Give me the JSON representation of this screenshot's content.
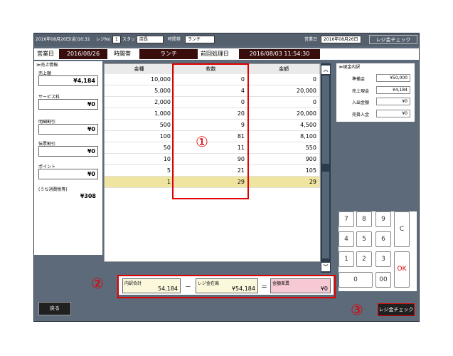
{
  "header": {
    "date_time": "2016年08月26日(金)16:32",
    "regi_no_label": "レジNo",
    "regi_no": "1",
    "staff_label": "スタッフ",
    "staff": "店長",
    "time_zone_label": "時間帯",
    "time_zone": "ランチ",
    "business_day_label": "営業日",
    "business_day": "2016年08月26日",
    "regi_check_button": "レジ金チェック"
  },
  "info": {
    "business_day_label": "営業日",
    "business_day": "2016/08/26",
    "time_zone_label": "時間帯",
    "time_zone": "ランチ",
    "last_process_label": "前回処理日",
    "last_process": "2016/08/03 11:54:30"
  },
  "sales": {
    "title": "≫売上情報",
    "items": [
      {
        "label": "売上額",
        "value": "¥4,184"
      },
      {
        "label": "サービス料",
        "value": "¥0"
      },
      {
        "label": "明細割引",
        "value": "¥0"
      },
      {
        "label": "伝票割引",
        "value": "¥0"
      },
      {
        "label": "ポイント",
        "value": "¥0"
      },
      {
        "label": "(うち消費税等)",
        "value": "¥308"
      }
    ]
  },
  "grid": {
    "headers": [
      "金種",
      "枚数",
      "金額"
    ],
    "rows": [
      [
        "10,000",
        "0",
        "0"
      ],
      [
        "5,000",
        "4",
        "20,000"
      ],
      [
        "2,000",
        "0",
        "0"
      ],
      [
        "1,000",
        "20",
        "20,000"
      ],
      [
        "500",
        "9",
        "4,500"
      ],
      [
        "100",
        "81",
        "8,100"
      ],
      [
        "50",
        "11",
        "550"
      ],
      [
        "10",
        "90",
        "900"
      ],
      [
        "5",
        "21",
        "105"
      ],
      [
        "1",
        "29",
        "29"
      ]
    ]
  },
  "cash": {
    "title": "≫現金内訳",
    "items": [
      {
        "label": "準備金",
        "value": "¥50,000"
      },
      {
        "label": "売上現金",
        "value": "¥4,184"
      },
      {
        "label": "入出金額",
        "value": "¥0"
      },
      {
        "label": "売掛入金",
        "value": "¥0"
      }
    ]
  },
  "keypad": {
    "keys": [
      "7",
      "8",
      "9",
      "4",
      "5",
      "6",
      "1",
      "2",
      "3",
      "0",
      "00"
    ],
    "clear": "C",
    "ok": "OK"
  },
  "totals": {
    "breakdown_label": "内訳合計",
    "breakdown": "54,184",
    "minus": "－",
    "balance_label": "レジ金在高",
    "balance": "¥54,184",
    "equals": "＝",
    "diff_label": "金額差異",
    "diff": "¥0"
  },
  "annotations": {
    "one": "①",
    "two": "②",
    "three": "③"
  },
  "buttons": {
    "back": "戻る",
    "regi_check": "レジ金チェック"
  },
  "scroll": {
    "up": "︽",
    "down": "︾"
  }
}
